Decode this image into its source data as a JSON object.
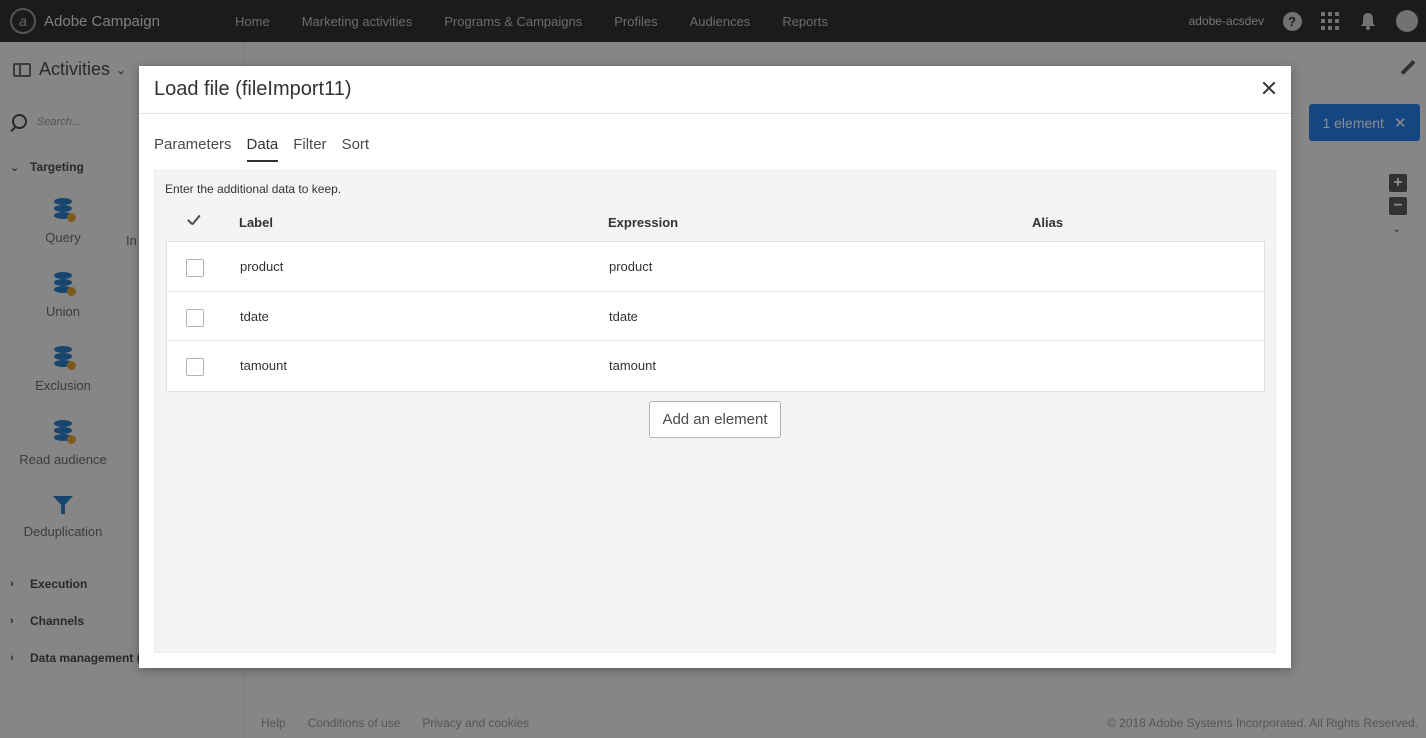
{
  "topbar": {
    "brand": "Adobe Campaign",
    "nav": [
      "Home",
      "Marketing activities",
      "Programs & Campaigns",
      "Profiles",
      "Audiences",
      "Reports"
    ],
    "org": "adobe-acsdev"
  },
  "sidebar": {
    "title": "Activities",
    "search_placeholder": "Search...",
    "sections": {
      "targeting": "Targeting",
      "execution": "Execution",
      "channels": "Channels",
      "data_management": "Data management ("
    },
    "activities": {
      "query": "Query",
      "partial": "In",
      "union": "Union",
      "exclusion": "Exclusion",
      "read_audience": "Read audience",
      "deduplication": "Deduplication"
    }
  },
  "selection": {
    "label": "1 element"
  },
  "footer": {
    "links": [
      "Help",
      "Conditions of use",
      "Privacy and cookies"
    ],
    "copyright": "© 2018 Adobe Systems Incorporated. All Rights Reserved."
  },
  "dialog": {
    "title": "Load file (fileImport11)",
    "tabs": [
      "Parameters",
      "Data",
      "Filter",
      "Sort"
    ],
    "active_tab": "Data",
    "description": "Enter the additional data to keep.",
    "columns": {
      "label": "Label",
      "expression": "Expression",
      "alias": "Alias"
    },
    "rows": [
      {
        "label": "product",
        "expression": "product",
        "alias": ""
      },
      {
        "label": "tdate",
        "expression": "tdate",
        "alias": ""
      },
      {
        "label": "tamount",
        "expression": "tamount",
        "alias": ""
      }
    ],
    "add_button": "Add an element"
  },
  "colors": {
    "topbar": "#323232",
    "accent": "#2680eb",
    "activity_icon": "#2d7fc9"
  }
}
